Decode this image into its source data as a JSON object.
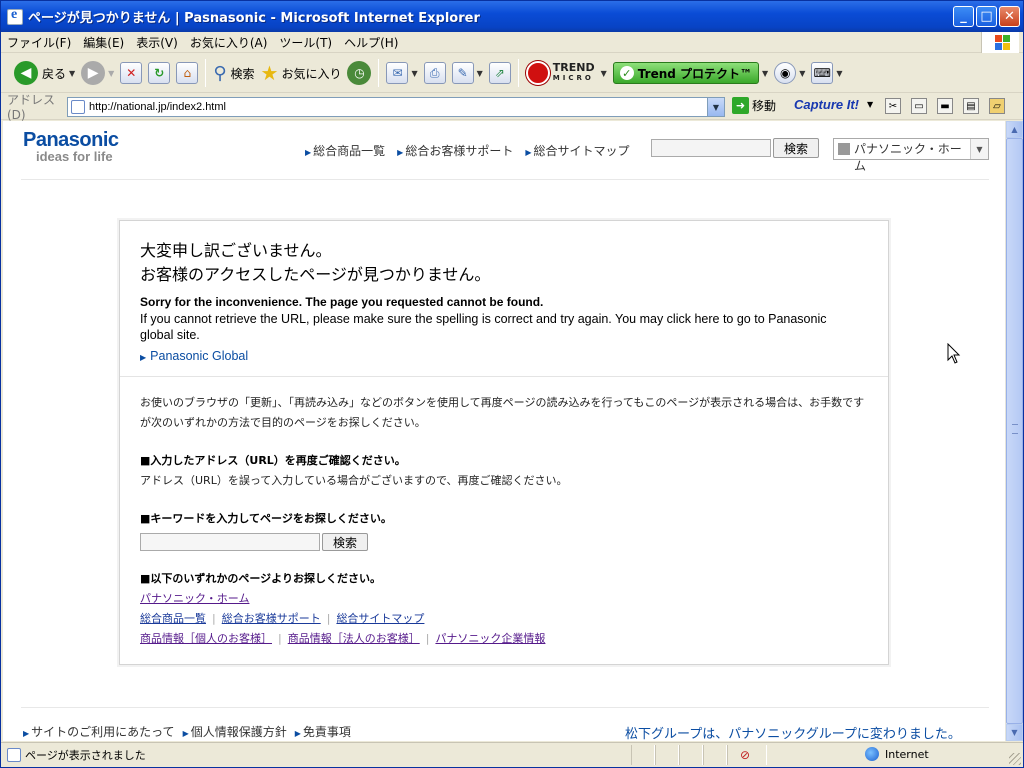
{
  "window": {
    "title": "ページが見つかりません | Pasnasonic - Microsoft Internet Explorer",
    "controls": {
      "minimize": "_",
      "maximize": "□",
      "close": "✕"
    }
  },
  "menubar": {
    "items": [
      "ファイル(F)",
      "編集(E)",
      "表示(V)",
      "お気に入り(A)",
      "ツール(T)",
      "ヘルプ(H)"
    ]
  },
  "toolbar": {
    "back": "戻る",
    "search": "検索",
    "favorites": "お気に入り",
    "trend_top": "TREND",
    "trend_bottom": "MICRO",
    "trend_protect": "Trend プロテクト™"
  },
  "addressbar": {
    "label": "アドレス(D)",
    "url": "http://national.jp/index2.html",
    "go": "移動",
    "capture": "Capture It!"
  },
  "page": {
    "logo": {
      "brand": "Panasonic",
      "tagline": "ideas for life"
    },
    "topnav": [
      "総合商品一覧",
      "総合お客様サポート",
      "総合サイトマップ"
    ],
    "header_search": {
      "button": "検索"
    },
    "home_select": "パナソニック・ホーム",
    "error": {
      "jp_line1": "大変申し訳ございません。",
      "jp_line2": "お客様のアクセスしたページが見つかりません。",
      "en_bold": "Sorry for the inconvenience. The page you requested cannot be found.",
      "en_text": "If you cannot retrieve the URL, please make sure the spelling is correct and try again. You may click here to go to Panasonic global site.",
      "global_link": "Panasonic Global",
      "para": "お使いのブラウザの「更新」、「再読み込み」などのボタンを使用して再度ページの読み込みを行ってもこのページが表示される場合は、お手数ですが次のいずれかの方法で目的のページをお探しください。",
      "sec1_head": "■入力したアドレス（URL）を再度ご確認ください。",
      "sec1_text": "アドレス（URL）を誤って入力している場合がございますので、再度ご確認ください。",
      "sec2_head": "■キーワードを入力してページをお探しください。",
      "sec2_button": "検索",
      "sec3_head": "■以下のいずれかのページよりお探しください。",
      "link_home": "パナソニック・ホーム",
      "links_row1": [
        "総合商品一覧",
        "総合お客様サポート",
        "総合サイトマップ"
      ],
      "links_row2": [
        "商品情報［個人のお客様］",
        "商品情報［法人のお客様］",
        "パナソニック企業情報"
      ]
    },
    "footer": {
      "links": [
        "サイトのご利用にあたって",
        "個人情報保護方針",
        "免責事項"
      ],
      "notice": "松下グループは、パナソニックグループに変わりました。"
    }
  },
  "statusbar": {
    "text": "ページが表示されました",
    "zone": "Internet"
  },
  "colors": {
    "panasonic_blue": "#0b4da2",
    "xp_title": "#0a4cd6"
  }
}
